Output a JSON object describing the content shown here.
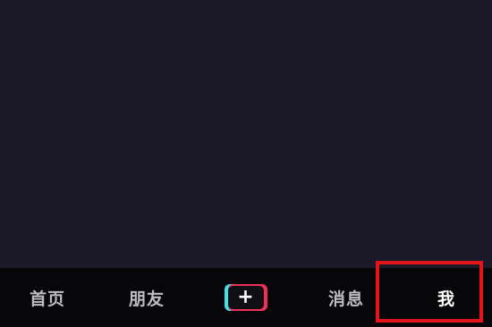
{
  "bottom_nav": {
    "home": "首页",
    "friends": "朋友",
    "create": "+",
    "inbox": "消息",
    "me": "我",
    "active_tab": "me"
  },
  "colors": {
    "background": "#1c1a28",
    "nav_background": "#07070a",
    "highlight": "#e3141a",
    "accent_cyan": "#3fe4e6",
    "accent_red": "#f0305a"
  },
  "annotation": {
    "highlight_target": "tab-me"
  }
}
